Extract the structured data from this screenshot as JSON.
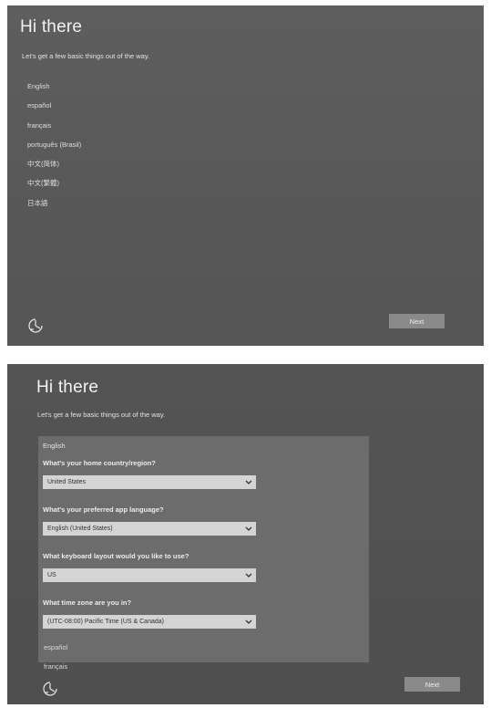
{
  "screen1": {
    "title": "Hi there",
    "subtitle": "Let's get a few basic things out of the way.",
    "languages": [
      "English",
      "español",
      "français",
      "português (Brasil)",
      "中文(简体)",
      "中文(繁體)",
      "日本語"
    ],
    "next_label": "Next",
    "accessibility_icon": "ease-of-access-icon"
  },
  "screen2": {
    "title": "Hi there",
    "subtitle": "Let's get a few basic things out of the way.",
    "selected_language": "English",
    "questions": [
      {
        "label": "What's your home country/region?",
        "value": "United States"
      },
      {
        "label": "What's your preferred app language?",
        "value": "English (United States)"
      },
      {
        "label": "What keyboard layout would you like to use?",
        "value": "US"
      },
      {
        "label": "What time zone are you in?",
        "value": "(UTC-08:00) Pacific Time (US & Canada)"
      }
    ],
    "languages_below": [
      "español",
      "français"
    ],
    "next_label": "Next",
    "accessibility_icon": "ease-of-access-icon"
  }
}
